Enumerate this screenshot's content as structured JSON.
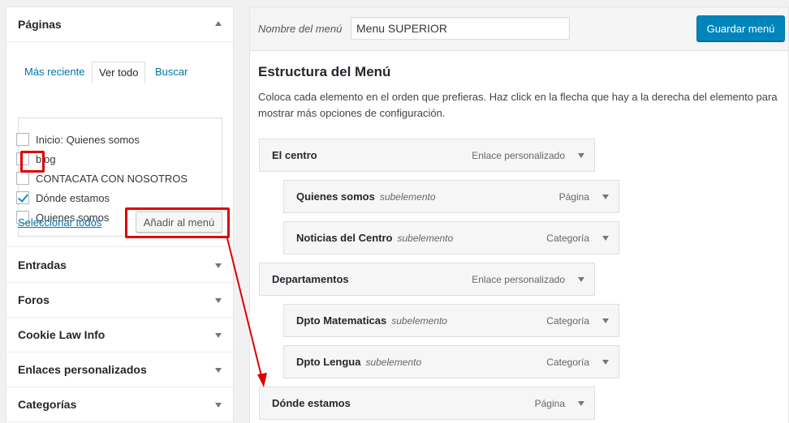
{
  "sidebar": {
    "pages": {
      "title": "Páginas",
      "tabs": [
        "Más reciente",
        "Ver todo",
        "Buscar"
      ],
      "items": [
        {
          "label": "Inicio: Quienes somos",
          "checked": false
        },
        {
          "label": "blog",
          "checked": false
        },
        {
          "label": "CONTACATA CON NOSOTROS",
          "checked": false
        },
        {
          "label": "Dónde estamos",
          "checked": true
        },
        {
          "label": "Quienes somos",
          "checked": false
        }
      ],
      "select_all": "Seleccionar todos",
      "add_button": "Añadir al menú"
    },
    "sections": [
      "Entradas",
      "Foros",
      "Cookie Law Info",
      "Enlaces personalizados",
      "Categorías"
    ]
  },
  "menu": {
    "name_label": "Nombre del menú",
    "name_value": "Menu SUPERIOR",
    "save_button": "Guardar menú",
    "structure_title": "Estructura del Menú",
    "structure_desc": "Coloca cada elemento en el orden que prefieras. Haz click en la flecha que hay a la derecha del elemento para mostrar más opciones de configuración.",
    "items": [
      {
        "title": "El centro",
        "sub": "",
        "type": "Enlace personalizado",
        "depth": 0
      },
      {
        "title": "Quienes somos",
        "sub": "subelemento",
        "type": "Página",
        "depth": 1
      },
      {
        "title": "Noticias del Centro",
        "sub": "subelemento",
        "type": "Categoría",
        "depth": 1
      },
      {
        "title": "Departamentos",
        "sub": "",
        "type": "Enlace personalizado",
        "depth": 0
      },
      {
        "title": "Dpto Matematicas",
        "sub": "subelemento",
        "type": "Categoría",
        "depth": 1
      },
      {
        "title": "Dpto Lengua",
        "sub": "subelemento",
        "type": "Categoría",
        "depth": 1
      },
      {
        "title": "Dónde estamos",
        "sub": "",
        "type": "Página",
        "depth": 0
      }
    ]
  },
  "colors": {
    "accent": "#0085ba",
    "highlight": "#e00000",
    "link": "#0073aa"
  }
}
